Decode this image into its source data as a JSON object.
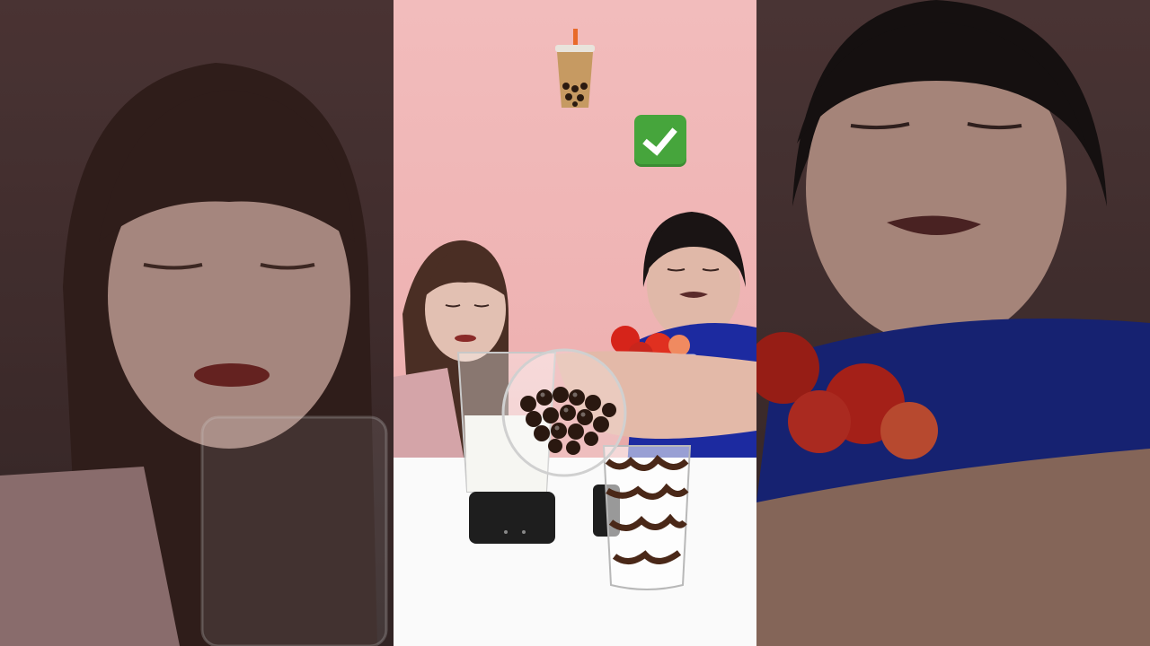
{
  "video": {
    "overlay_icons": [
      "bubble-tea-emoji",
      "check-mark-emoji"
    ]
  },
  "colors": {
    "wall_pink": "#f0b8b8",
    "table_white": "#fafafa",
    "check_green": "#46a53c",
    "shirt_blue": "#1c2aa0"
  }
}
